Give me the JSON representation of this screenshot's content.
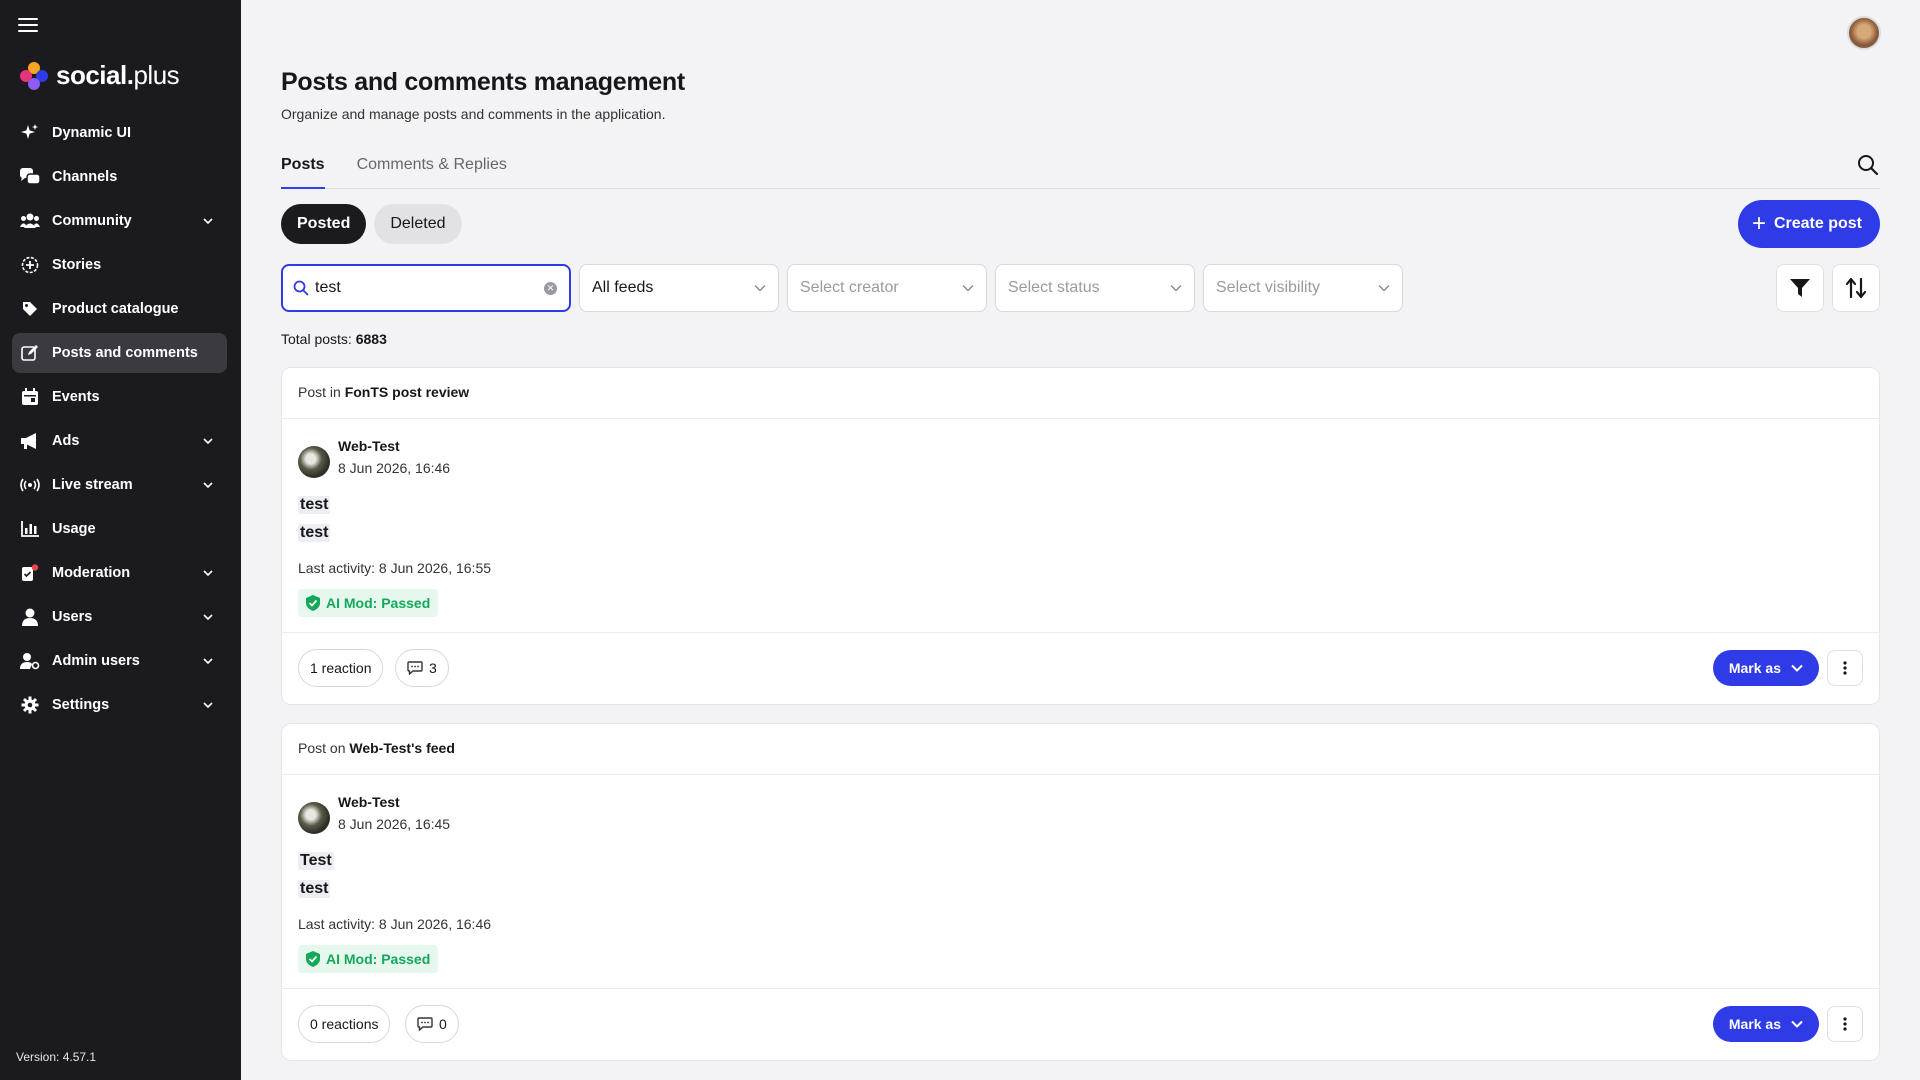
{
  "sidebar": {
    "brand": {
      "bold": "social",
      "dot": ".",
      "light": "plus"
    },
    "items": [
      {
        "label": "Dynamic UI",
        "icon": "sparkle-icon",
        "chevron": false,
        "active": false
      },
      {
        "label": "Channels",
        "icon": "chat-bubbles-icon",
        "chevron": false,
        "active": false
      },
      {
        "label": "Community",
        "icon": "people-icon",
        "chevron": true,
        "active": false
      },
      {
        "label": "Stories",
        "icon": "stories-icon",
        "chevron": false,
        "active": false
      },
      {
        "label": "Product catalogue",
        "icon": "tag-icon",
        "chevron": false,
        "active": false
      },
      {
        "label": "Posts and comments",
        "icon": "edit-icon",
        "chevron": false,
        "active": true
      },
      {
        "label": "Events",
        "icon": "calendar-icon",
        "chevron": false,
        "active": false
      },
      {
        "label": "Ads",
        "icon": "megaphone-icon",
        "chevron": true,
        "active": false
      },
      {
        "label": "Live stream",
        "icon": "broadcast-icon",
        "chevron": true,
        "active": false
      },
      {
        "label": "Usage",
        "icon": "bar-chart-icon",
        "chevron": false,
        "active": false
      },
      {
        "label": "Moderation",
        "icon": "moderation-icon",
        "chevron": true,
        "active": false
      },
      {
        "label": "Users",
        "icon": "user-icon",
        "chevron": true,
        "active": false
      },
      {
        "label": "Admin users",
        "icon": "admin-user-icon",
        "chevron": true,
        "active": false
      },
      {
        "label": "Settings",
        "icon": "gear-icon",
        "chevron": true,
        "active": false
      }
    ],
    "version": "Version: 4.57.1"
  },
  "header": {
    "title": "Posts and comments management",
    "subtitle": "Organize and manage posts and comments in the application."
  },
  "tabs": [
    "Posts",
    "Comments & Replies"
  ],
  "segments": [
    "Posted",
    "Deleted"
  ],
  "create_label": "Create post",
  "filters": {
    "search_value": "test",
    "feeds_value": "All feeds",
    "creator_placeholder": "Select creator",
    "status_placeholder": "Select status",
    "visibility_placeholder": "Select visibility"
  },
  "total": {
    "label": "Total posts:",
    "value": "6883"
  },
  "posts": [
    {
      "head_prefix": "Post in",
      "head_target": "FonTS post review",
      "author": "Web-Test",
      "date": "8 Jun 2026, 16:46",
      "lines": [
        "test",
        "test"
      ],
      "activity": "Last activity: 8 Jun 2026, 16:55",
      "mod": "AI Mod: Passed",
      "reactions": "1 reaction",
      "comments": "3",
      "mark_label": "Mark as"
    },
    {
      "head_prefix": "Post on",
      "head_target": "Web-Test's feed",
      "author": "Web-Test",
      "date": "8 Jun 2026, 16:45",
      "lines": [
        "Test",
        "test"
      ],
      "activity": "Last activity: 8 Jun 2026, 16:46",
      "mod": "AI Mod: Passed",
      "reactions": "0 reactions",
      "comments": "0",
      "mark_label": "Mark as"
    }
  ],
  "colors": {
    "accent": "#2f3be6",
    "sidebar": "#1b1b1f",
    "success": "#14a85a"
  }
}
